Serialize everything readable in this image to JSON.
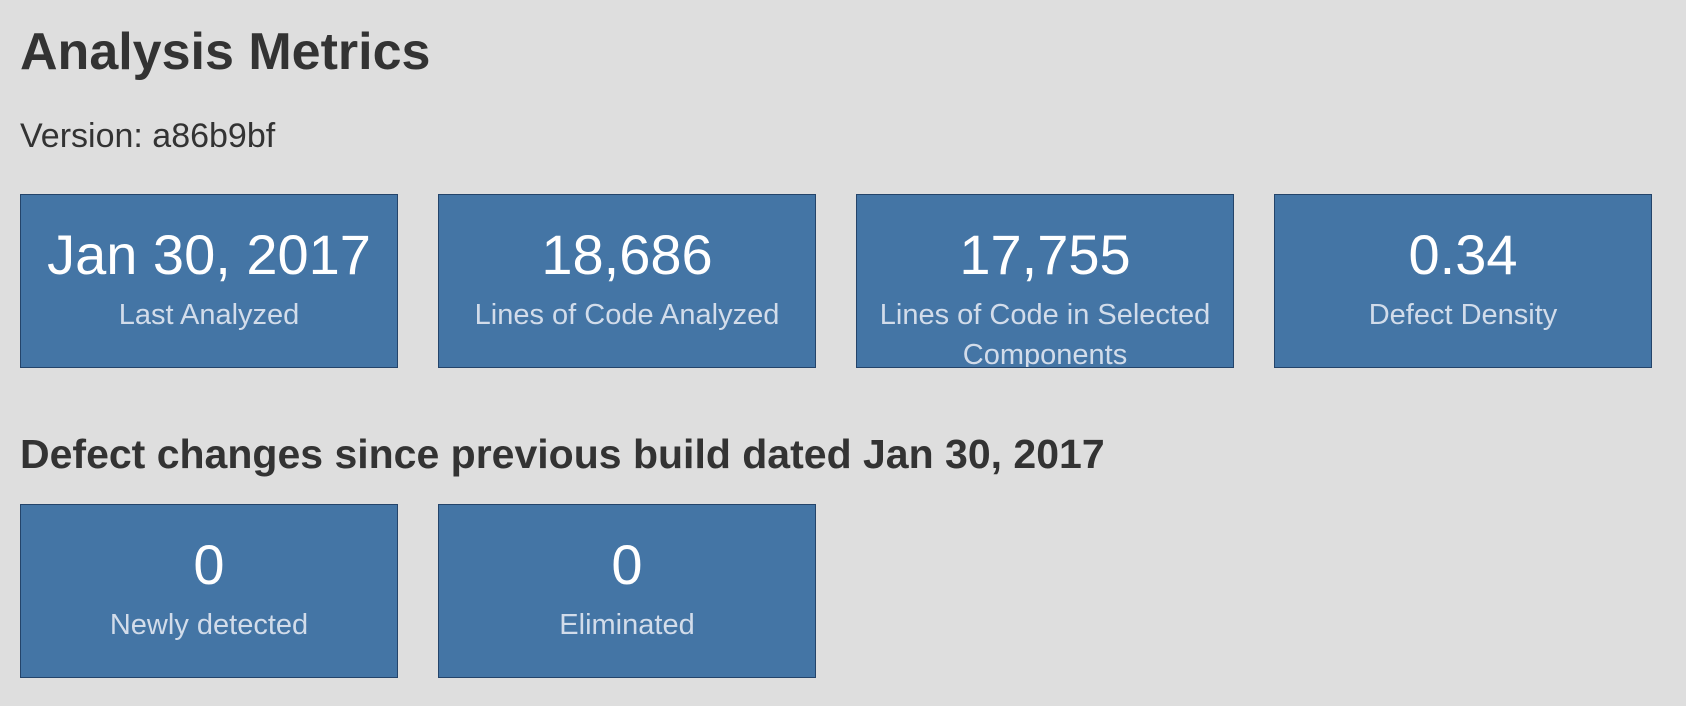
{
  "page": {
    "title": "Analysis Metrics",
    "version_label": "Version: a86b9bf",
    "changes_heading": "Defect changes since previous build dated Jan 30, 2017"
  },
  "metrics": [
    {
      "value": "Jan 30, 2017",
      "label": "Last Analyzed"
    },
    {
      "value": "18,686",
      "label": "Lines of Code Analyzed"
    },
    {
      "value": "17,755",
      "label": "Lines of Code in Selected Components"
    },
    {
      "value": "0.34",
      "label": "Defect Density"
    }
  ],
  "changes": [
    {
      "value": "0",
      "label": "Newly detected"
    },
    {
      "value": "0",
      "label": "Eliminated"
    }
  ],
  "colors": {
    "background": "#dedede",
    "tile": "#4475a5",
    "tile_border": "#24446a",
    "tile_value": "#ffffff",
    "tile_label": "#d2dcea",
    "text": "#333333"
  }
}
